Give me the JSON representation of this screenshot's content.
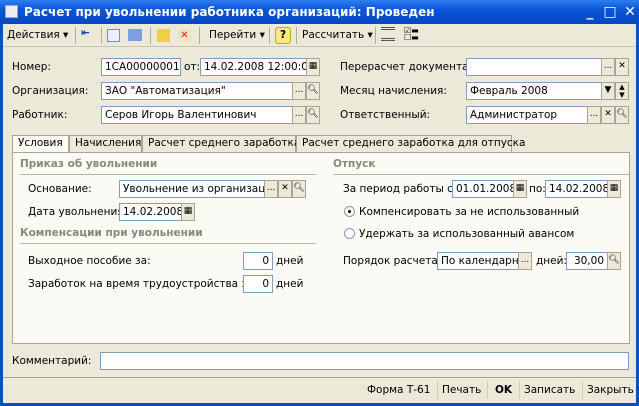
{
  "window": {
    "title": "Расчет при увольнении работника организаций: Проведен"
  },
  "toolbar": {
    "actions": "Действия ▾",
    "goto": "Перейти ▾",
    "help": "?",
    "calculate": "Рассчитать ▾"
  },
  "header": {
    "number_label": "Номер:",
    "number": "1CA00000001",
    "date_label": "от:",
    "date": "14.02.2008 12:00:00",
    "org_label": "Организация:",
    "org": "ЗАО \"Автоматизация\"",
    "employee_label": "Работник:",
    "employee": "Серов Игорь Валентинович",
    "recalc_label": "Перерасчет документа:",
    "recalc": "",
    "month_label": "Месяц начисления:",
    "month": "Февраль 2008",
    "resp_label": "Ответственный:",
    "resp": "Администратор"
  },
  "tabs": [
    {
      "label": "Условия",
      "active": true
    },
    {
      "label": "Начисления"
    },
    {
      "label": "Расчет среднего заработка"
    },
    {
      "label": "Расчет среднего заработка для отпуска"
    }
  ],
  "order": {
    "title": "Приказ об увольнении",
    "basis_label": "Основание:",
    "basis": "Увольнение из организаци",
    "date_label": "Дата увольнения:",
    "date": "14.02.2008"
  },
  "comp": {
    "title": "Компенсации при увольнении",
    "severance_label": "Выходное пособие за:",
    "severance": "0",
    "days": "дней",
    "employment_label": "Заработок на время трудоустройства за:",
    "employment": "0"
  },
  "vacation": {
    "title": "Отпуск",
    "period_label": "За период работы с:",
    "from": "01.01.2008",
    "to_label": "по:",
    "to": "14.02.2008",
    "radio1": "Компенсировать за не использованный",
    "radio2": "Удержать за использованный авансом",
    "order_label": "Порядок расчета:",
    "order": "По календарнь",
    "days_label": "дней:",
    "days": "30,00"
  },
  "comment": {
    "label": "Комментарий:",
    "value": ""
  },
  "footer": {
    "form": "Форма Т-61",
    "print": "Печать",
    "ok": "OK",
    "save": "Записать",
    "close": "Закрыть"
  }
}
